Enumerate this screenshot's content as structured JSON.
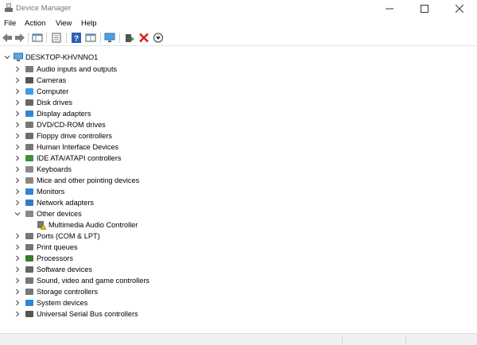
{
  "window": {
    "title": "Device Manager"
  },
  "menu": [
    "File",
    "Action",
    "View",
    "Help"
  ],
  "toolbar": {
    "buttons": [
      "back-icon",
      "forward-icon",
      "properties-grid-icon",
      "document-icon",
      "help-icon",
      "grid-icon",
      "monitor-icon",
      "update-driver-icon",
      "uninstall-icon",
      "download-icon"
    ]
  },
  "tree": {
    "root": "DESKTOP-KHVNNO1",
    "items": [
      {
        "label": "Audio inputs and outputs",
        "icon": "speaker-icon"
      },
      {
        "label": "Cameras",
        "icon": "camera-icon"
      },
      {
        "label": "Computer",
        "icon": "computer-icon"
      },
      {
        "label": "Disk drives",
        "icon": "disk-drive-icon"
      },
      {
        "label": "Display adapters",
        "icon": "display-adapter-icon"
      },
      {
        "label": "DVD/CD-ROM drives",
        "icon": "dvd-drive-icon"
      },
      {
        "label": "Floppy drive controllers",
        "icon": "floppy-controller-icon"
      },
      {
        "label": "Human Interface Devices",
        "icon": "hid-icon"
      },
      {
        "label": "IDE ATA/ATAPI controllers",
        "icon": "ide-controller-icon"
      },
      {
        "label": "Keyboards",
        "icon": "keyboard-icon"
      },
      {
        "label": "Mice and other pointing devices",
        "icon": "mouse-icon"
      },
      {
        "label": "Monitors",
        "icon": "monitor-icon"
      },
      {
        "label": "Network adapters",
        "icon": "network-adapter-icon"
      },
      {
        "label": "Other devices",
        "icon": "unknown-device-icon",
        "expanded": true,
        "children": [
          {
            "label": "Multimedia Audio Controller",
            "icon": "warning-device-icon"
          }
        ]
      },
      {
        "label": "Ports (COM & LPT)",
        "icon": "port-icon"
      },
      {
        "label": "Print queues",
        "icon": "printer-icon"
      },
      {
        "label": "Processors",
        "icon": "processor-icon"
      },
      {
        "label": "Software devices",
        "icon": "software-device-icon"
      },
      {
        "label": "Sound, video and game controllers",
        "icon": "sound-icon"
      },
      {
        "label": "Storage controllers",
        "icon": "storage-controller-icon"
      },
      {
        "label": "System devices",
        "icon": "system-device-icon"
      },
      {
        "label": "Universal Serial Bus controllers",
        "icon": "usb-icon"
      }
    ]
  }
}
